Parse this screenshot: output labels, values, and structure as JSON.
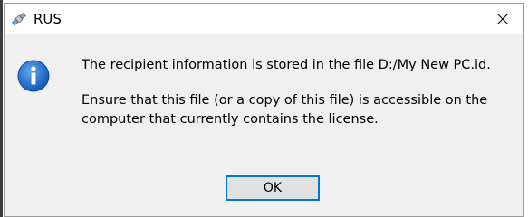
{
  "window": {
    "title": "RUS",
    "app_icon": "satellite-icon",
    "close_icon": "close-icon"
  },
  "dialog": {
    "icon": "information-icon",
    "message_line1": "The recipient information is stored in the file D:/My New PC.id.",
    "message_line2": "Ensure that this file (or a copy of this file) is accessible on the computer that currently contains the license.",
    "ok_label": "OK"
  },
  "colors": {
    "accent": "#0078d7",
    "dialog_bg": "#f0f0f0",
    "titlebar_bg": "#ffffff",
    "info_icon": "#1d6fc9"
  }
}
